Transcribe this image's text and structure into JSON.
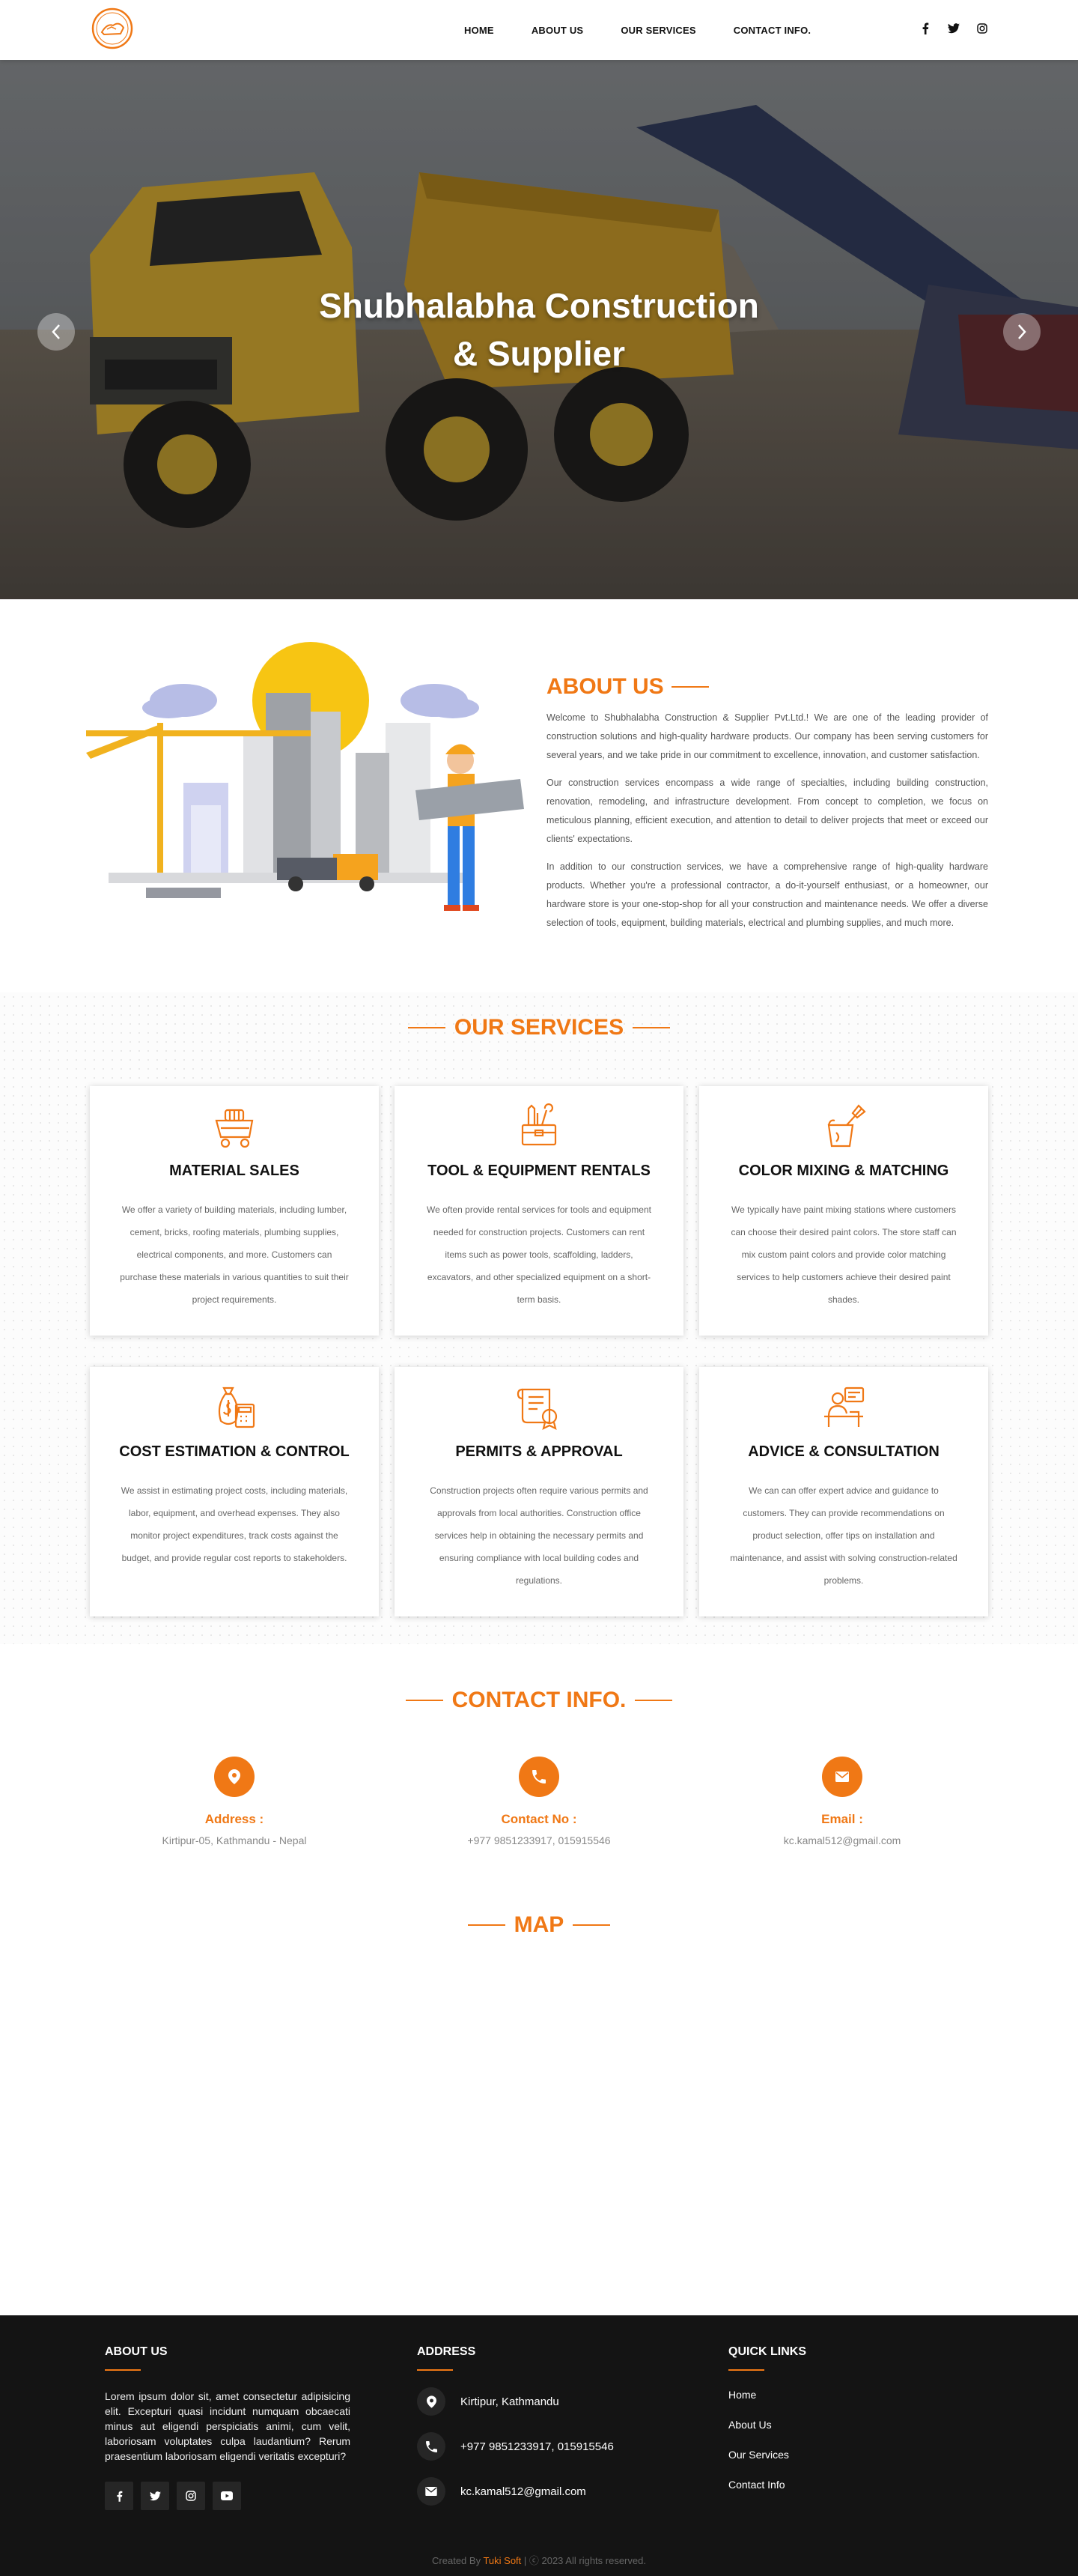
{
  "nav": {
    "items": [
      "HOME",
      "ABOUT US",
      "OUR SERVICES",
      "CONTACT INFO."
    ]
  },
  "hero": {
    "title_line1": "Shubhalabha Construction",
    "title_line2": "& Supplier"
  },
  "about": {
    "heading": "ABOUT US",
    "paragraphs": [
      "Welcome to Shubhalabha Construction & Supplier Pvt.Ltd.! We are one of the leading provider of construction solutions and high-quality hardware products. Our company has been serving customers for several years, and we take pride in our commitment to excellence, innovation, and customer satisfaction.",
      "Our construction services encompass a wide range of specialties, including building construction, renovation, remodeling, and infrastructure development. From concept to completion, we focus on meticulous planning, efficient execution, and attention to detail to deliver projects that meet or exceed our clients' expectations.",
      "In addition to our construction services, we have a comprehensive range of high-quality hardware products. Whether you're a professional contractor, a do-it-yourself enthusiast, or a homeowner, our hardware store is your one-stop-shop for all your construction and maintenance needs. We offer a diverse selection of tools, equipment, building materials, electrical and plumbing supplies, and much more."
    ]
  },
  "services": {
    "heading": "OUR SERVICES",
    "cards": [
      {
        "title": "MATERIAL SALES",
        "icon": "cart-bricks-icon",
        "text": "We offer a variety of building materials, including lumber, cement, bricks, roofing materials, plumbing supplies, electrical components, and more. Customers can purchase these materials in various quantities to suit their project requirements."
      },
      {
        "title": "TOOL & EQUIPMENT RENTALS",
        "icon": "toolbox-icon",
        "text": "We often provide rental services for tools and equipment needed for construction projects. Customers can rent items such as power tools, scaffolding, ladders, excavators, and other specialized equipment on a short-term basis."
      },
      {
        "title": "COLOR MIXING & MATCHING",
        "icon": "paint-bucket-icon",
        "text": "We typically have paint mixing stations where customers can choose their desired paint colors. The store staff can mix custom paint colors and provide color matching services to help customers achieve their desired paint shades."
      },
      {
        "title": "COST ESTIMATION & CONTROL",
        "icon": "calculator-money-icon",
        "text": "We assist in estimating project costs, including materials, labor, equipment, and overhead expenses. They also monitor project expenditures, track costs against the budget, and provide regular cost reports to stakeholders."
      },
      {
        "title": "PERMITS & APPROVAL",
        "icon": "certificate-icon",
        "text": "Construction projects often require various permits and approvals from local authorities. Construction office services help in obtaining the necessary permits and ensuring compliance with local building codes and regulations."
      },
      {
        "title": "ADVICE & CONSULTATION",
        "icon": "consultant-icon",
        "text": "We can can offer expert advice and guidance to customers. They can provide recommendations on product selection, offer tips on installation and maintenance, and assist with solving construction-related problems."
      }
    ]
  },
  "contact": {
    "heading": "CONTACT INFO.",
    "items": [
      {
        "label": "Address :",
        "value": "Kirtipur-05, Kathmandu - Nepal"
      },
      {
        "label": "Contact No :",
        "value": "+977 9851233917, 015915546"
      },
      {
        "label": "Email :",
        "value": "kc.kamal512@gmail.com"
      }
    ]
  },
  "map": {
    "heading": "MAP"
  },
  "footer": {
    "about_heading": "ABOUT US",
    "about_text": "Lorem ipsum dolor sit, amet consectetur adipisicing elit. Excepturi quasi incidunt numquam obcaecati minus aut eligendi perspiciatis animi, cum velit, laboriosam voluptates culpa laudantium? Rerum praesentium laboriosam eligendi veritatis excepturi?",
    "address_heading": "ADDRESS",
    "address": "Kirtipur, Kathmandu",
    "phone": "+977 9851233917, 015915546",
    "email": "kc.kamal512@gmail.com",
    "links_heading": "QUICK LINKS",
    "links": [
      "Home",
      "About Us",
      "Our Services",
      "Contact Info"
    ],
    "copy_prefix": "Created By ",
    "copy_brand": "Tuki Soft",
    "copy_suffix": " | ⓒ 2023 All rights reserved."
  },
  "colors": {
    "accent": "#f07815",
    "footer_bg": "#141414"
  }
}
